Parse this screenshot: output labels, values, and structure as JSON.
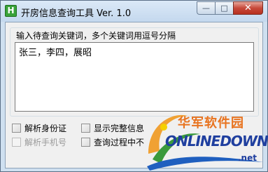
{
  "window": {
    "title": "开房信息查询工具 Ver. 1.0",
    "app_icon_glyph": "H",
    "controls": {
      "minimize": "—",
      "maximize": "□",
      "close": "✕"
    }
  },
  "keywords": {
    "group_label": "输入待查询关键词，多个关键词用逗号分隔",
    "value": "张三，李四，展昭"
  },
  "options": [
    {
      "label": "解析身份证",
      "checked": false,
      "enabled": true
    },
    {
      "label": "显示完整信息",
      "checked": false,
      "enabled": true
    },
    {
      "label": "解析手机号",
      "checked": false,
      "enabled": false
    },
    {
      "label": "查询过程中不",
      "checked": false,
      "enabled": true
    }
  ],
  "watermark": {
    "cn": "华军软件园",
    "en": "ONLINEDOWN",
    "suffix": ".net"
  },
  "colors": {
    "title_bg": "#cfe0f0",
    "close_red": "#c7493a",
    "watermark_orange": "#e8731f",
    "watermark_blue": "#1f3f9f"
  }
}
